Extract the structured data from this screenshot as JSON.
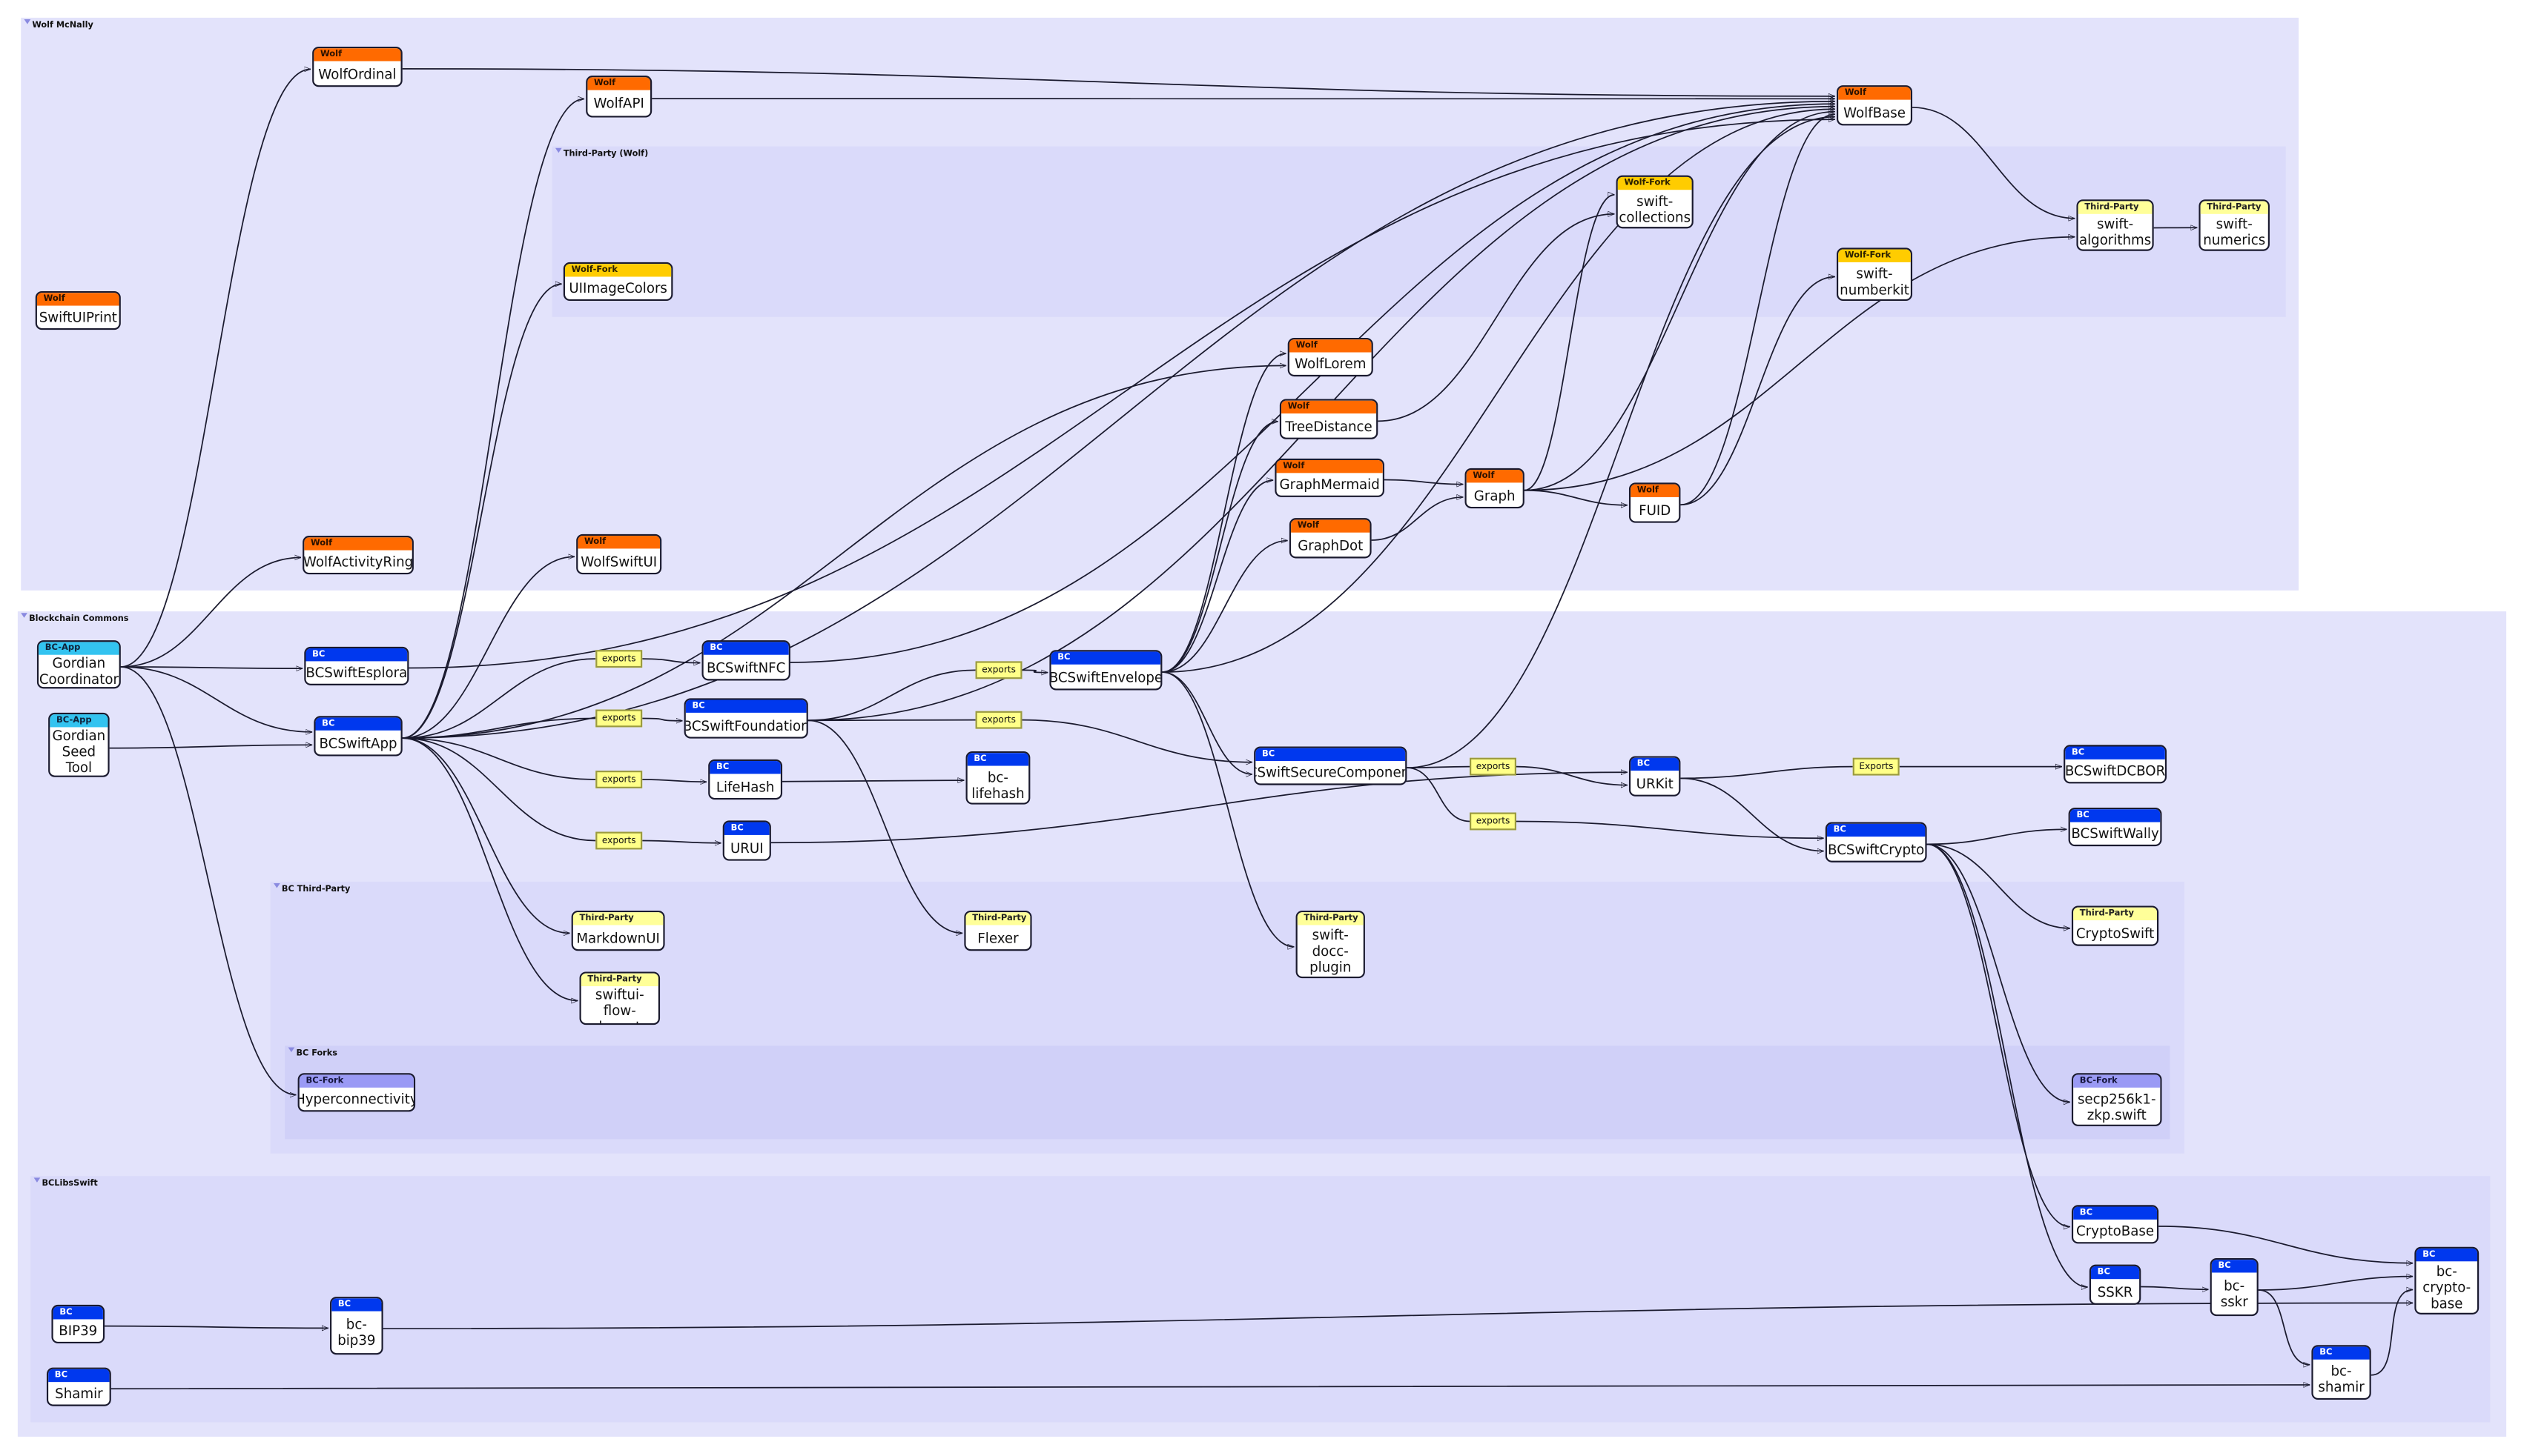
{
  "groups": [
    {
      "id": "wolf",
      "title": "Wolf McNally"
    },
    {
      "id": "thirdwolf",
      "title": "Third-Party (Wolf)"
    },
    {
      "id": "bc",
      "title": "Blockchain Commons"
    },
    {
      "id": "bcthird",
      "title": "BC Third-Party"
    },
    {
      "id": "bcforks",
      "title": "BC Forks"
    },
    {
      "id": "bclibs",
      "title": "BCLibsSwift"
    }
  ],
  "tag_colors": {
    "Wolf": "#ff6a00",
    "Wolf-Fork": "#ffcc00",
    "Third-Party": "#ffff99",
    "BC": "#0038ee",
    "BC-App": "#33c3f0",
    "BC-Fork": "#9a9af5"
  },
  "nodes": [
    {
      "id": "SwiftUIPrint",
      "tag": "Wolf",
      "label": "SwiftUIPrint"
    },
    {
      "id": "WolfOrdinal",
      "tag": "Wolf",
      "label": "WolfOrdinal"
    },
    {
      "id": "WolfAPI",
      "tag": "Wolf",
      "label": "WolfAPI"
    },
    {
      "id": "UIImageColors",
      "tag": "Wolf-Fork",
      "label": "UIImageColors"
    },
    {
      "id": "WolfBase",
      "tag": "Wolf",
      "label": "WolfBase"
    },
    {
      "id": "swift-collections",
      "tag": "Wolf-Fork",
      "label": "swift-\ncollections"
    },
    {
      "id": "swift-algorithms",
      "tag": "Third-Party",
      "label": "swift-\nalgorithms"
    },
    {
      "id": "swift-numerics",
      "tag": "Third-Party",
      "label": "swift-\nnumerics"
    },
    {
      "id": "swift-numberkit",
      "tag": "Wolf-Fork",
      "label": "swift-\nnumberkit"
    },
    {
      "id": "WolfLorem",
      "tag": "Wolf",
      "label": "WolfLorem"
    },
    {
      "id": "TreeDistance",
      "tag": "Wolf",
      "label": "TreeDistance"
    },
    {
      "id": "GraphMermaid",
      "tag": "Wolf",
      "label": "GraphMermaid"
    },
    {
      "id": "Graph",
      "tag": "Wolf",
      "label": "Graph"
    },
    {
      "id": "FUID",
      "tag": "Wolf",
      "label": "FUID"
    },
    {
      "id": "GraphDot",
      "tag": "Wolf",
      "label": "GraphDot"
    },
    {
      "id": "WolfActivityRing",
      "tag": "Wolf",
      "label": "WolfActivityRing"
    },
    {
      "id": "WolfSwiftUI",
      "tag": "Wolf",
      "label": "WolfSwiftUI"
    },
    {
      "id": "GordianCoordinator",
      "tag": "BC-App",
      "label": "Gordian\nCoordinator"
    },
    {
      "id": "GordianSeedTool",
      "tag": "BC-App",
      "label": "Gordian\nSeed\nTool"
    },
    {
      "id": "BCSwiftEsplora",
      "tag": "BC",
      "label": "BCSwiftEsplora"
    },
    {
      "id": "BCSwiftApp",
      "tag": "BC",
      "label": "BCSwiftApp"
    },
    {
      "id": "BCSwiftNFC",
      "tag": "BC",
      "label": "BCSwiftNFC"
    },
    {
      "id": "BCSwiftFoundation",
      "tag": "BC",
      "label": "BCSwiftFoundation"
    },
    {
      "id": "LifeHash",
      "tag": "BC",
      "label": "LifeHash"
    },
    {
      "id": "URUI",
      "tag": "BC",
      "label": "URUI"
    },
    {
      "id": "bc-lifehash",
      "tag": "BC",
      "label": "bc-\nlifehash"
    },
    {
      "id": "BCSwiftEnvelope",
      "tag": "BC",
      "label": "BCSwiftEnvelope"
    },
    {
      "id": "BCSwiftSecureComponents",
      "tag": "BC",
      "label": "BCSwiftSecureComponents"
    },
    {
      "id": "URKit",
      "tag": "BC",
      "label": "URKit"
    },
    {
      "id": "BCSwiftDCBOR",
      "tag": "BC",
      "label": "BCSwiftDCBOR"
    },
    {
      "id": "BCSwiftWally",
      "tag": "BC",
      "label": "BCSwiftWally"
    },
    {
      "id": "BCSwiftCrypto",
      "tag": "BC",
      "label": "BCSwiftCrypto"
    },
    {
      "id": "MarkdownUI",
      "tag": "Third-Party",
      "label": "MarkdownUI"
    },
    {
      "id": "swiftui-flow-layout",
      "tag": "Third-Party",
      "label": "swiftui-\nflow-layout"
    },
    {
      "id": "Flexer",
      "tag": "Third-Party",
      "label": "Flexer"
    },
    {
      "id": "swift-docc-plugin",
      "tag": "Third-Party",
      "label": "swift-\ndocc-\nplugin"
    },
    {
      "id": "CryptoSwift",
      "tag": "Third-Party",
      "label": "CryptoSwift"
    },
    {
      "id": "Hyperconnectivity",
      "tag": "BC-Fork",
      "label": "Hyperconnectivity"
    },
    {
      "id": "secp256k1-zkp",
      "tag": "BC-Fork",
      "label": "secp256k1-\nzkp.swift"
    },
    {
      "id": "CryptoBase",
      "tag": "BC",
      "label": "CryptoBase"
    },
    {
      "id": "SSKR",
      "tag": "BC",
      "label": "SSKR"
    },
    {
      "id": "bc-sskr",
      "tag": "BC",
      "label": "bc-\nsskr"
    },
    {
      "id": "bc-crypto-base",
      "tag": "BC",
      "label": "bc-\ncrypto-\nbase"
    },
    {
      "id": "bc-shamir",
      "tag": "BC",
      "label": "bc-\nshamir"
    },
    {
      "id": "BIP39",
      "tag": "BC",
      "label": "BIP39"
    },
    {
      "id": "bc-bip39",
      "tag": "BC",
      "label": "bc-\nbip39"
    },
    {
      "id": "Shamir",
      "tag": "BC",
      "label": "Shamir"
    }
  ],
  "edge_labels": [
    {
      "id": "ex1",
      "text": "exports"
    },
    {
      "id": "ex2",
      "text": "exports"
    },
    {
      "id": "ex3",
      "text": "exports"
    },
    {
      "id": "ex4",
      "text": "exports"
    },
    {
      "id": "ex5",
      "text": "exports"
    },
    {
      "id": "ex6",
      "text": "exports"
    },
    {
      "id": "ex7",
      "text": "exports"
    },
    {
      "id": "ex8",
      "text": "exports"
    },
    {
      "id": "ex9",
      "text": "Exports"
    }
  ],
  "edges": [
    {
      "from": "WolfOrdinal",
      "to": "WolfBase"
    },
    {
      "from": "WolfAPI",
      "to": "WolfBase"
    },
    {
      "from": "BCSwiftApp",
      "to": "WolfBase"
    },
    {
      "from": "BCSwiftNFC",
      "to": "WolfBase"
    },
    {
      "from": "BCSwiftFoundation",
      "to": "WolfBase"
    },
    {
      "from": "BCSwiftEnvelope",
      "to": "WolfBase"
    },
    {
      "from": "Graph",
      "to": "WolfBase"
    },
    {
      "from": "FUID",
      "to": "WolfBase"
    },
    {
      "from": "BCSwiftSecureComponents",
      "to": "WolfBase"
    },
    {
      "from": "WolfBase",
      "to": "swift-algorithms"
    },
    {
      "from": "swift-algorithms",
      "to": "swift-numerics"
    },
    {
      "from": "Graph",
      "to": "swift-algorithms"
    },
    {
      "from": "Graph",
      "to": "swift-collections"
    },
    {
      "from": "TreeDistance",
      "to": "swift-collections"
    },
    {
      "from": "FUID",
      "to": "swift-numberkit"
    },
    {
      "from": "GraphMermaid",
      "to": "Graph"
    },
    {
      "from": "GraphDot",
      "to": "Graph"
    },
    {
      "from": "Graph",
      "to": "FUID"
    },
    {
      "from": "BCSwiftEnvelope",
      "to": "WolfLorem"
    },
    {
      "from": "BCSwiftEnvelope",
      "to": "TreeDistance"
    },
    {
      "from": "BCSwiftEnvelope",
      "to": "GraphMermaid"
    },
    {
      "from": "BCSwiftEnvelope",
      "to": "GraphDot"
    },
    {
      "from": "BCSwiftApp",
      "to": "WolfLorem"
    },
    {
      "from": "BCSwiftApp",
      "to": "WolfAPI"
    },
    {
      "from": "BCSwiftApp",
      "to": "UIImageColors"
    },
    {
      "from": "BCSwiftApp",
      "to": "WolfSwiftUI"
    },
    {
      "from": "GordianCoordinator",
      "to": "WolfOrdinal"
    },
    {
      "from": "GordianCoordinator",
      "to": "WolfActivityRing"
    },
    {
      "from": "GordianCoordinator",
      "to": "BCSwiftEsplora"
    },
    {
      "from": "GordianCoordinator",
      "to": "BCSwiftApp"
    },
    {
      "from": "GordianCoordinator",
      "to": "Hyperconnectivity"
    },
    {
      "from": "GordianSeedTool",
      "to": "BCSwiftApp"
    },
    {
      "from": "BCSwiftEsplora",
      "to": "WolfBase"
    },
    {
      "from": "BCSwiftApp",
      "to": "BCSwiftNFC",
      "label": "ex1"
    },
    {
      "from": "BCSwiftApp",
      "to": "BCSwiftFoundation",
      "label": "ex2"
    },
    {
      "from": "BCSwiftApp",
      "to": "LifeHash",
      "label": "ex3"
    },
    {
      "from": "BCSwiftApp",
      "to": "URUI",
      "label": "ex4"
    },
    {
      "from": "BCSwiftApp",
      "to": "MarkdownUI"
    },
    {
      "from": "BCSwiftApp",
      "to": "swiftui-flow-layout"
    },
    {
      "from": "BCSwiftFoundation",
      "to": "BCSwiftEnvelope",
      "label": "ex5"
    },
    {
      "from": "BCSwiftFoundation",
      "to": "BCSwiftSecureComponents",
      "label": "ex6"
    },
    {
      "from": "BCSwiftFoundation",
      "to": "Flexer"
    },
    {
      "from": "LifeHash",
      "to": "bc-lifehash"
    },
    {
      "from": "URUI",
      "to": "URKit"
    },
    {
      "from": "BCSwiftEnvelope",
      "to": "BCSwiftSecureComponents"
    },
    {
      "from": "BCSwiftEnvelope",
      "to": "swift-docc-plugin"
    },
    {
      "from": "BCSwiftSecureComponents",
      "to": "URKit",
      "label": "ex7"
    },
    {
      "from": "BCSwiftSecureComponents",
      "to": "BCSwiftCrypto",
      "label": "ex8"
    },
    {
      "from": "URKit",
      "to": "BCSwiftDCBOR",
      "label": "ex9"
    },
    {
      "from": "URKit",
      "to": "BCSwiftCrypto"
    },
    {
      "from": "BCSwiftCrypto",
      "to": "BCSwiftWally"
    },
    {
      "from": "BCSwiftCrypto",
      "to": "CryptoSwift"
    },
    {
      "from": "BCSwiftCrypto",
      "to": "secp256k1-zkp"
    },
    {
      "from": "BCSwiftCrypto",
      "to": "CryptoBase"
    },
    {
      "from": "BCSwiftCrypto",
      "to": "SSKR"
    },
    {
      "from": "CryptoBase",
      "to": "bc-crypto-base"
    },
    {
      "from": "SSKR",
      "to": "bc-sskr"
    },
    {
      "from": "bc-sskr",
      "to": "bc-crypto-base"
    },
    {
      "from": "bc-sskr",
      "to": "bc-shamir"
    },
    {
      "from": "bc-shamir",
      "to": "bc-crypto-base"
    },
    {
      "from": "BIP39",
      "to": "bc-bip39"
    },
    {
      "from": "bc-bip39",
      "to": "bc-crypto-base"
    },
    {
      "from": "Shamir",
      "to": "bc-shamir"
    }
  ]
}
